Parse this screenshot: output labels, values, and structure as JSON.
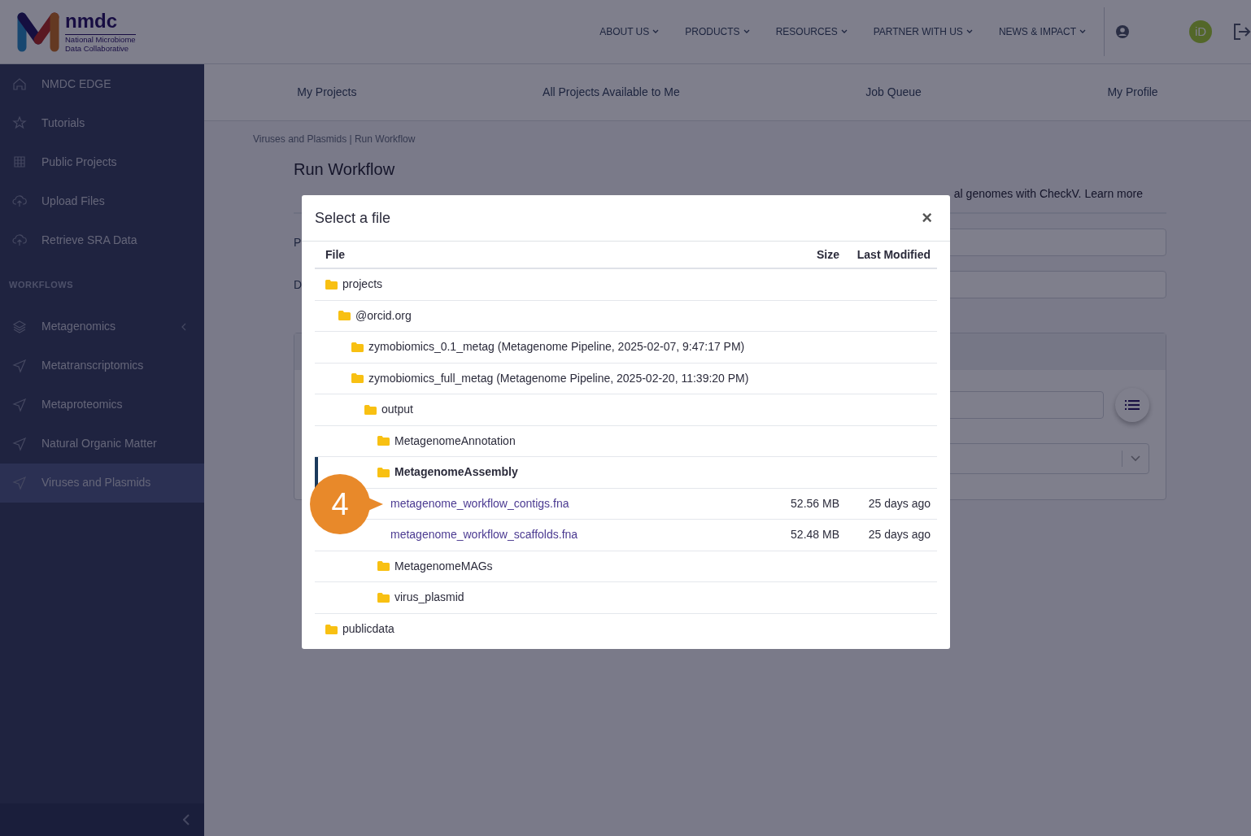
{
  "logo": {
    "name": "nmdc",
    "subtitle": [
      "National Microbiome",
      "Data Collaborative"
    ]
  },
  "top_nav": [
    {
      "label": "ABOUT US"
    },
    {
      "label": "PRODUCTS"
    },
    {
      "label": "RESOURCES"
    },
    {
      "label": "PARTNER WITH US"
    },
    {
      "label": "NEWS & IMPACT"
    }
  ],
  "orcid_badge": "iD",
  "sidebar": {
    "items": [
      {
        "label": "NMDC EDGE",
        "kind": "home",
        "selected": false
      },
      {
        "label": "Tutorials",
        "kind": "star",
        "selected": false
      },
      {
        "label": "Public Projects",
        "kind": "grid",
        "selected": false
      },
      {
        "label": "Upload Files",
        "kind": "upload",
        "selected": false
      },
      {
        "label": "Retrieve SRA Data",
        "kind": "upload",
        "selected": false
      }
    ],
    "section_title": "WORKFLOWS",
    "workflows": [
      {
        "label": "Metagenomics",
        "kind": "layers",
        "selected": false,
        "expandable": true
      },
      {
        "label": "Metatranscriptomics",
        "kind": "send",
        "selected": false,
        "expandable": false
      },
      {
        "label": "Metaproteomics",
        "kind": "send",
        "selected": false,
        "expandable": false
      },
      {
        "label": "Natural Organic Matter",
        "kind": "send",
        "selected": false,
        "expandable": false
      },
      {
        "label": "Viruses and Plasmids",
        "kind": "send",
        "selected": true,
        "expandable": false
      }
    ]
  },
  "sub_nav": [
    {
      "label": "My Projects"
    },
    {
      "label": "All Projects Available to Me"
    },
    {
      "label": "Job Queue"
    },
    {
      "label": "My Profile"
    }
  ],
  "breadcrumb": "Viruses and Plasmids | Run Workflow",
  "page_title": "Run Workflow",
  "description": {
    "text": "al genomes with CheckV.",
    "link": "Learn more"
  },
  "form_labels": [
    "P",
    "D"
  ],
  "modal": {
    "title": "Select a file",
    "close": "×",
    "columns": [
      "File",
      "Size",
      "Last Modified"
    ],
    "tree": [
      {
        "name": "projects",
        "kind": "folder",
        "selected": false,
        "children": [
          {
            "name": "@orcid.org",
            "kind": "folder",
            "selected": false,
            "children": [
              {
                "name": "zymobiomics_0.1_metag (Metagenome Pipeline, 2025-02-07, 9:47:17 PM)",
                "kind": "folder",
                "selected": false
              },
              {
                "name": "zymobiomics_full_metag (Metagenome Pipeline, 2025-02-20, 11:39:20 PM)",
                "kind": "folder",
                "selected": false,
                "children": [
                  {
                    "name": "output",
                    "kind": "folder",
                    "selected": false,
                    "children": [
                      {
                        "name": "MetagenomeAnnotation",
                        "kind": "folder",
                        "selected": false
                      },
                      {
                        "name": "MetagenomeAssembly",
                        "kind": "folder",
                        "selected": true,
                        "children": [
                          {
                            "name": "metagenome_workflow_contigs.fna",
                            "kind": "file",
                            "selected": false,
                            "size": "52.56 MB",
                            "modified": "25 days ago"
                          },
                          {
                            "name": "metagenome_workflow_scaffolds.fna",
                            "kind": "file",
                            "selected": false,
                            "size": "52.48 MB",
                            "modified": "25 days ago"
                          }
                        ]
                      },
                      {
                        "name": "MetagenomeMAGs",
                        "kind": "folder",
                        "selected": false
                      },
                      {
                        "name": "virus_plasmid",
                        "kind": "folder",
                        "selected": false
                      }
                    ]
                  }
                ]
              }
            ]
          }
        ]
      },
      {
        "name": "publicdata",
        "kind": "folder",
        "selected": false
      }
    ]
  },
  "callout": {
    "label": "4"
  }
}
